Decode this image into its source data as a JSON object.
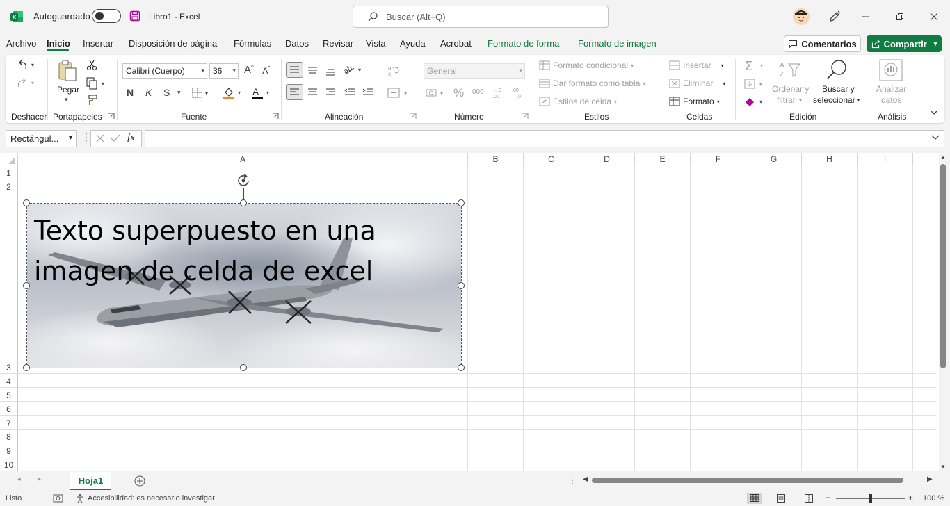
{
  "titlebar": {
    "autosave_label": "Autoguardado",
    "doc_title": "Libro1  -  Excel",
    "search_placeholder": "Buscar (Alt+Q)",
    "brand_color": "#107c41"
  },
  "tabs": [
    {
      "label": "Archivo",
      "active": false
    },
    {
      "label": "Inicio",
      "active": true
    },
    {
      "label": "Insertar",
      "active": false
    },
    {
      "label": "Disposición de página",
      "active": false
    },
    {
      "label": "Fórmulas",
      "active": false
    },
    {
      "label": "Datos",
      "active": false
    },
    {
      "label": "Revisar",
      "active": false
    },
    {
      "label": "Vista",
      "active": false
    },
    {
      "label": "Ayuda",
      "active": false
    },
    {
      "label": "Acrobat",
      "active": false
    },
    {
      "label": "Formato de forma",
      "contextual": true
    },
    {
      "label": "Formato de imagen",
      "contextual": true
    }
  ],
  "actions": {
    "comments": "Comentarios",
    "share": "Compartir"
  },
  "ribbon": {
    "groups": {
      "undo": "Deshacer",
      "clipboard": "Portapapeles",
      "font": "Fuente",
      "alignment": "Alineación",
      "number": "Número",
      "styles": "Estilos",
      "cells": "Celdas",
      "editing": "Edición",
      "analysis": "Análisis"
    },
    "paste": "Pegar",
    "font_name": "Calibri (Cuerpo)",
    "font_size": "36",
    "bold": "N",
    "italic": "K",
    "underline": "S",
    "number_format": "General",
    "conditional_format": "Formato condicional",
    "format_as_table": "Dar formato como tabla",
    "cell_styles": "Estilos de celda",
    "insert": "Insertar",
    "delete": "Eliminar",
    "format": "Formato",
    "sort_filter_1": "Ordenar y",
    "sort_filter_2": "filtrar",
    "find_select_1": "Buscar y",
    "find_select_2": "seleccionar",
    "analyze_1": "Analizar",
    "analyze_2": "datos"
  },
  "formula_bar": {
    "name_box": "Rectángul...",
    "fx": "fx",
    "value": ""
  },
  "grid": {
    "columns": [
      "A",
      "B",
      "C",
      "D",
      "E",
      "F",
      "G",
      "H",
      "I"
    ],
    "rows": [
      "1",
      "2",
      "3",
      "4",
      "5",
      "6",
      "7",
      "8",
      "9",
      "10"
    ]
  },
  "picture": {
    "overlay_line1": "Texto superpuesto en una",
    "overlay_line2": "imagen de celda de excel"
  },
  "sheets": {
    "active": "Hoja1"
  },
  "status": {
    "ready": "Listo",
    "accessibility": "Accesibilidad: es necesario investigar",
    "zoom": "100 %"
  }
}
